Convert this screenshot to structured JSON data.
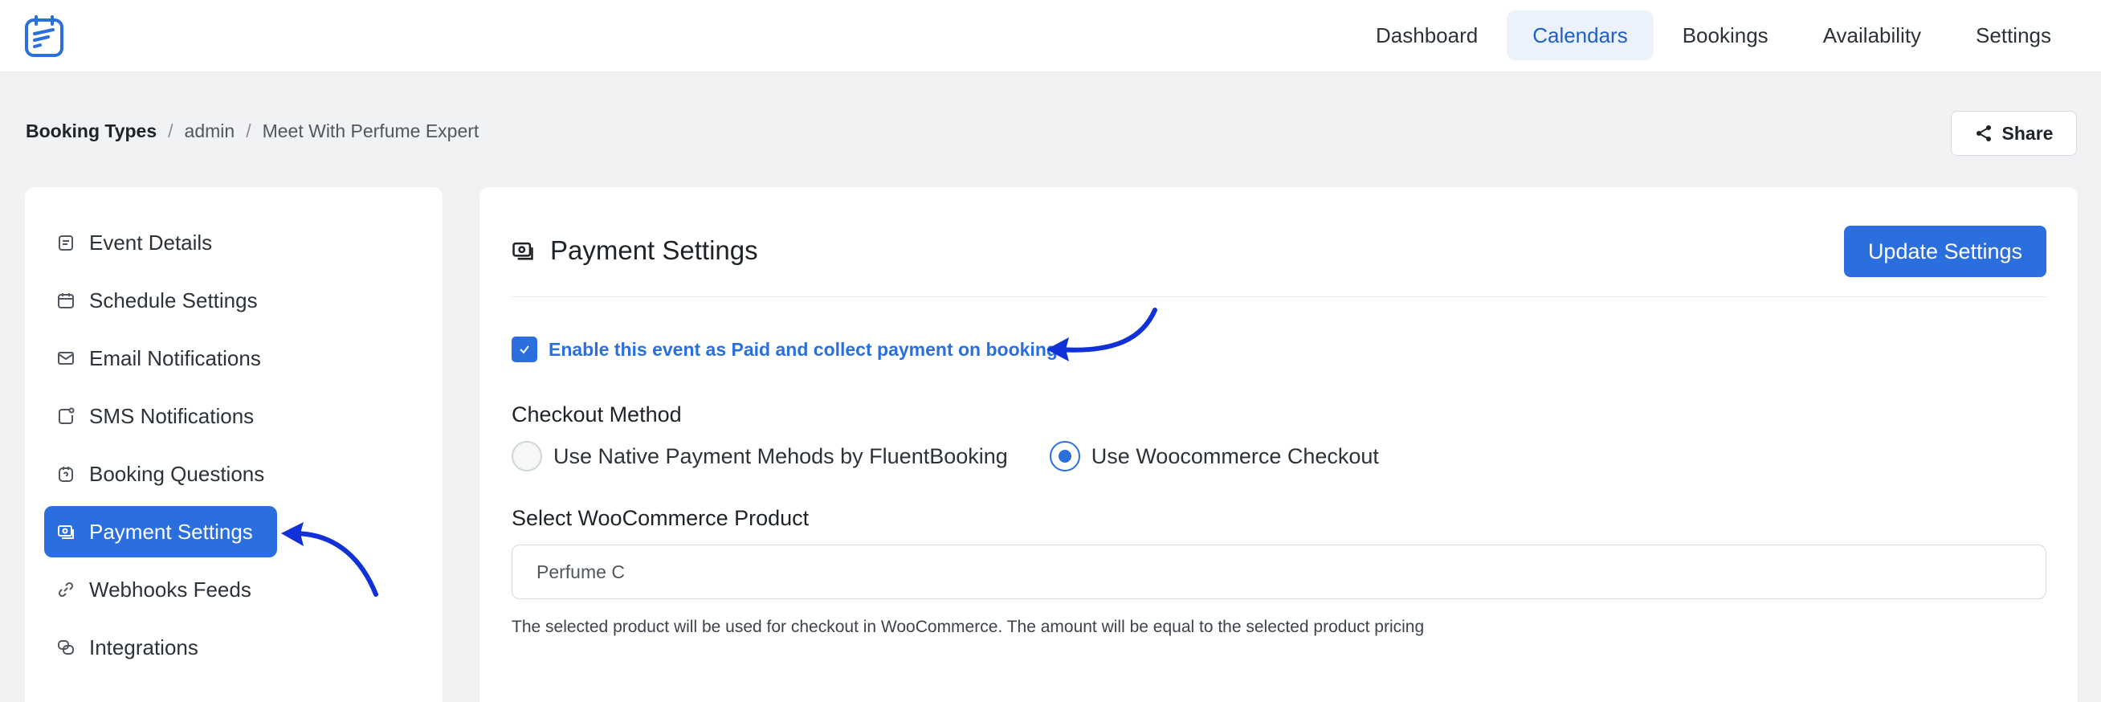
{
  "nav": {
    "logo_icon": "fluentbooking-logo-icon",
    "items": [
      {
        "label": "Dashboard",
        "active": false
      },
      {
        "label": "Calendars",
        "active": true
      },
      {
        "label": "Bookings",
        "active": false
      },
      {
        "label": "Availability",
        "active": false
      },
      {
        "label": "Settings",
        "active": false
      }
    ]
  },
  "breadcrumb": {
    "root": "Booking Types",
    "separator": "/",
    "user": "admin",
    "event": "Meet With Perfume Expert"
  },
  "share": {
    "label": "Share",
    "icon": "share-icon"
  },
  "sidebar": {
    "items": [
      {
        "label": "Event Details",
        "icon": "event-details-icon",
        "active": false
      },
      {
        "label": "Schedule Settings",
        "icon": "calendar-icon",
        "active": false
      },
      {
        "label": "Email Notifications",
        "icon": "envelope-icon",
        "active": false
      },
      {
        "label": "SMS Notifications",
        "icon": "sms-icon",
        "active": false
      },
      {
        "label": "Booking Questions",
        "icon": "question-icon",
        "active": false
      },
      {
        "label": "Payment Settings",
        "icon": "payment-icon",
        "active": true
      },
      {
        "label": "Webhooks Feeds",
        "icon": "link-icon",
        "active": false
      },
      {
        "label": "Integrations",
        "icon": "integrations-icon",
        "active": false
      }
    ]
  },
  "panel": {
    "title": "Payment Settings",
    "update_button": "Update Settings",
    "enable_paid": {
      "label": "Enable this event as Paid and collect payment on booking",
      "checked": true
    },
    "checkout_method": {
      "label": "Checkout Method",
      "options": [
        {
          "label": "Use Native Payment Mehods by FluentBooking",
          "selected": false
        },
        {
          "label": "Use Woocommerce Checkout",
          "selected": true
        }
      ]
    },
    "product": {
      "label": "Select WooCommerce Product",
      "value": "Perfume C",
      "help": "The selected product will be used for checkout in WooCommerce. The amount will be equal to the selected product pricing"
    }
  },
  "colors": {
    "accent": "#2b6fdf",
    "annotation_arrow": "#1030d8",
    "nav_active_bg": "#ebf2fc"
  }
}
